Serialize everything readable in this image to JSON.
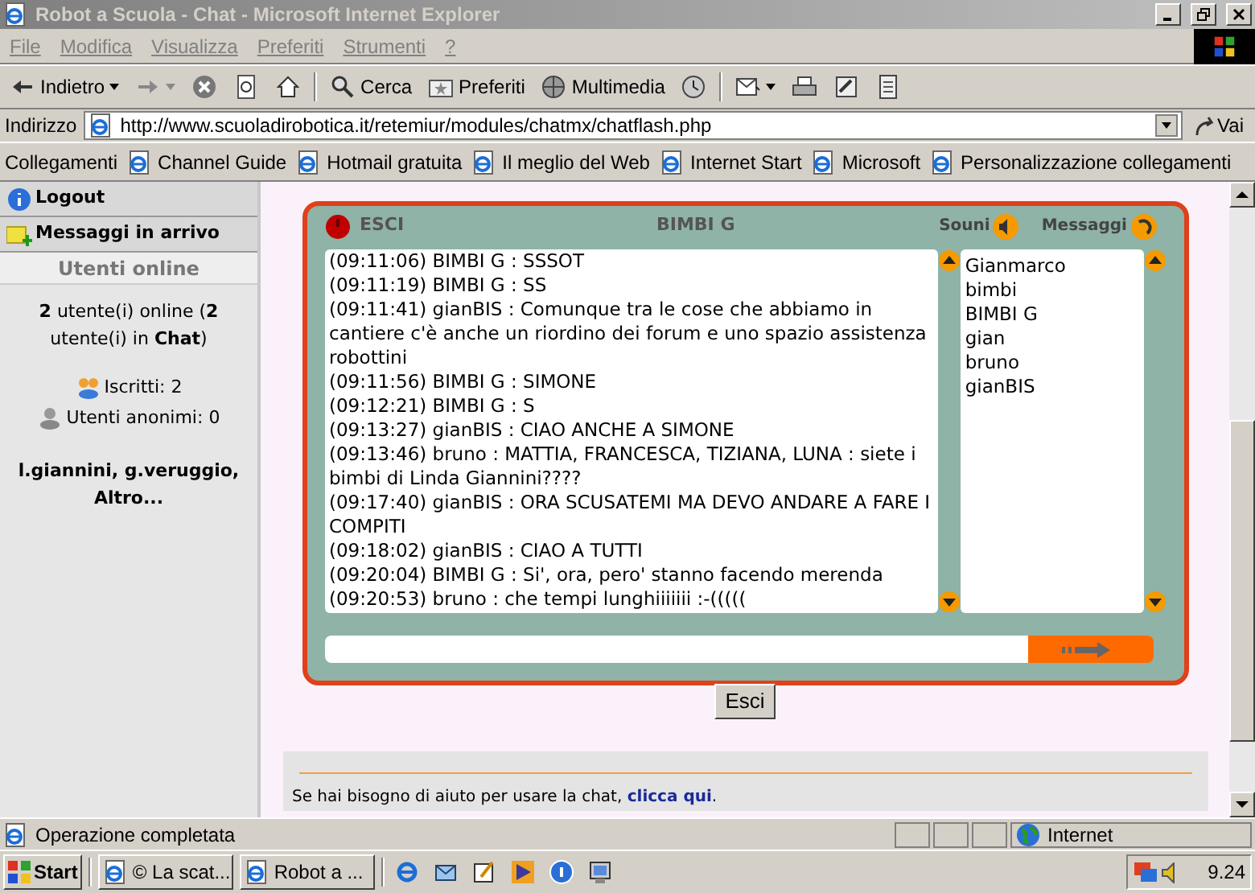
{
  "window": {
    "title": "Robot a Scuola - Chat - Microsoft Internet Explorer"
  },
  "menu": [
    "File",
    "Modifica",
    "Visualizza",
    "Preferiti",
    "Strumenti",
    "?"
  ],
  "toolbar": [
    {
      "kind": "back",
      "label": "Indietro"
    },
    {
      "kind": "forward"
    },
    {
      "kind": "stop"
    },
    {
      "kind": "refresh"
    },
    {
      "kind": "home"
    },
    {
      "kind": "search",
      "label": "Cerca"
    },
    {
      "kind": "favorites",
      "label": "Preferiti"
    },
    {
      "kind": "media",
      "label": "Multimedia"
    },
    {
      "kind": "history"
    },
    {
      "kind": "mail"
    },
    {
      "kind": "print"
    },
    {
      "kind": "edit"
    },
    {
      "kind": "discuss"
    }
  ],
  "address": {
    "label": "Indirizzo",
    "url": "http://www.scuoladirobotica.it/retemiur/modules/chatmx/chatflash.php",
    "go": "Vai"
  },
  "links": {
    "label": "Collegamenti",
    "items": [
      "Channel Guide",
      "Hotmail gratuita",
      "Il meglio del Web",
      "Internet Start",
      "Microsoft",
      "Personalizzazione collegamenti"
    ]
  },
  "sidebar": {
    "items": [
      {
        "kind": "logout",
        "label": "Logout"
      },
      {
        "kind": "inbox",
        "label": "Messaggi in arrivo"
      }
    ],
    "online": {
      "title": "Utenti online",
      "summary": "**2** utente(i) online (**2** utente(i) in **Chat**)",
      "registered": "Iscritti: 2",
      "anonymous": "Utenti anonimi: 0",
      "names": "l.giannini, g.veruggio, Altro..."
    }
  },
  "chat": {
    "exit": "ESCI",
    "room": "BIMBI G",
    "sound": "Souni",
    "messages_label": "Messaggi",
    "messages": [
      "(09:11:06) BIMBI G : SSSOT",
      "(09:11:19) BIMBI G : SS",
      "(09:11:41) gianBIS : Comunque tra le cose che abbiamo in cantiere c'è anche un riordino dei forum e uno spazio assistenza robottini",
      "(09:11:56) BIMBI G : SIMONE",
      "(09:12:21) BIMBI G : S",
      "(09:13:27) gianBIS : CIAO ANCHE A SIMONE",
      "(09:13:46) bruno : MATTIA, FRANCESCA, TIZIANA, LUNA : siete i bimbi di Linda Giannini????",
      "(09:17:40) gianBIS : ORA SCUSATEMI MA DEVO ANDARE A FARE I COMPITI",
      "(09:18:02) gianBIS : CIAO A TUTTI",
      "(09:20:04) BIMBI G : Si', ora, pero' stanno facendo merenda",
      "(09:20:53) bruno : che tempi lunghiiiiiii :-((((("
    ],
    "users": [
      "Gianmarco",
      "bimbi",
      "BIMBI G",
      "gian",
      "bruno",
      "gianBIS"
    ]
  },
  "exit_button": "Esci",
  "help": {
    "before": "Se hai bisogno di aiuto per usare la chat,",
    "link": "clicca qui",
    "after": "."
  },
  "status_bar": {
    "text": "Operazione completata",
    "zone": "Internet"
  },
  "taskbar": {
    "start": "Start",
    "tasks": [
      "© La scat...",
      "Robot a ..."
    ],
    "clock": "9.24"
  }
}
